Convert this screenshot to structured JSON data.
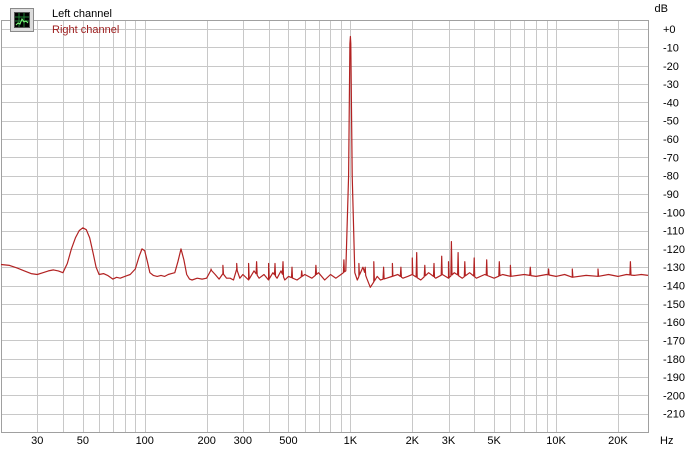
{
  "chart_data": {
    "type": "line",
    "title": "",
    "xscale": "log",
    "xlim": [
      20,
      28000
    ],
    "ylim": [
      -220,
      5
    ],
    "x_unit": "Hz",
    "y_unit": "dB",
    "x_ticks": [
      {
        "v": 30,
        "label": "30"
      },
      {
        "v": 50,
        "label": "50"
      },
      {
        "v": 100,
        "label": "100"
      },
      {
        "v": 200,
        "label": "200"
      },
      {
        "v": 300,
        "label": "300"
      },
      {
        "v": 500,
        "label": "500"
      },
      {
        "v": 1000,
        "label": "1K"
      },
      {
        "v": 2000,
        "label": "2K"
      },
      {
        "v": 3000,
        "label": "3K"
      },
      {
        "v": 5000,
        "label": "5K"
      },
      {
        "v": 10000,
        "label": "10K"
      },
      {
        "v": 20000,
        "label": "20K"
      }
    ],
    "y_ticks": [
      {
        "v": 0,
        "label": "+0"
      },
      {
        "v": -10,
        "label": "-10"
      },
      {
        "v": -20,
        "label": "-20"
      },
      {
        "v": -30,
        "label": "-30"
      },
      {
        "v": -40,
        "label": "-40"
      },
      {
        "v": -50,
        "label": "-50"
      },
      {
        "v": -60,
        "label": "-60"
      },
      {
        "v": -70,
        "label": "-70"
      },
      {
        "v": -80,
        "label": "-80"
      },
      {
        "v": -90,
        "label": "-90"
      },
      {
        "v": -100,
        "label": "-100"
      },
      {
        "v": -110,
        "label": "-110"
      },
      {
        "v": -120,
        "label": "-120"
      },
      {
        "v": -130,
        "label": "-130"
      },
      {
        "v": -140,
        "label": "-140"
      },
      {
        "v": -150,
        "label": "-150"
      },
      {
        "v": -160,
        "label": "-160"
      },
      {
        "v": -170,
        "label": "-170"
      },
      {
        "v": -180,
        "label": "-180"
      },
      {
        "v": -190,
        "label": "-190"
      },
      {
        "v": -200,
        "label": "-200"
      },
      {
        "v": -210,
        "label": "-210"
      }
    ],
    "grid": true,
    "legend_position": "top-left",
    "series": [
      {
        "name": "Left channel",
        "color": "#000000",
        "points": []
      },
      {
        "name": "Right channel",
        "color": "#b22222",
        "points": [
          [
            20,
            -128.5
          ],
          [
            22,
            -129
          ],
          [
            24,
            -130.5
          ],
          [
            26,
            -132
          ],
          [
            28,
            -133.5
          ],
          [
            30,
            -134
          ],
          [
            32,
            -133
          ],
          [
            34,
            -132
          ],
          [
            36,
            -131.5
          ],
          [
            38,
            -132
          ],
          [
            40,
            -133
          ],
          [
            42,
            -128
          ],
          [
            44,
            -120
          ],
          [
            46,
            -114
          ],
          [
            48,
            -110
          ],
          [
            50,
            -108.5
          ],
          [
            52,
            -109.5
          ],
          [
            54,
            -114
          ],
          [
            56,
            -122
          ],
          [
            58,
            -130
          ],
          [
            60,
            -134
          ],
          [
            63,
            -133.5
          ],
          [
            66,
            -134.5
          ],
          [
            70,
            -136.5
          ],
          [
            73,
            -135.5
          ],
          [
            76,
            -136
          ],
          [
            80,
            -135
          ],
          [
            85,
            -134
          ],
          [
            90,
            -131
          ],
          [
            94,
            -124
          ],
          [
            97,
            -120
          ],
          [
            100,
            -121
          ],
          [
            103,
            -127
          ],
          [
            106,
            -133
          ],
          [
            110,
            -134.5
          ],
          [
            115,
            -135
          ],
          [
            120,
            -134.5
          ],
          [
            125,
            -135
          ],
          [
            130,
            -134
          ],
          [
            135,
            -133.5
          ],
          [
            140,
            -133
          ],
          [
            145,
            -127
          ],
          [
            150,
            -120
          ],
          [
            155,
            -126
          ],
          [
            160,
            -134
          ],
          [
            165,
            -136.5
          ],
          [
            170,
            -137
          ],
          [
            180,
            -136
          ],
          [
            190,
            -136.5
          ],
          [
            200,
            -136
          ],
          [
            210,
            -131.5
          ],
          [
            220,
            -134
          ],
          [
            230,
            -136.5
          ],
          [
            240,
            -133.5
          ],
          [
            250,
            -136
          ],
          [
            260,
            -136
          ],
          [
            270,
            -137
          ],
          [
            280,
            -131
          ],
          [
            290,
            -136
          ],
          [
            300,
            -134
          ],
          [
            320,
            -137
          ],
          [
            340,
            -132
          ],
          [
            360,
            -136
          ],
          [
            380,
            -134
          ],
          [
            400,
            -137
          ],
          [
            420,
            -133
          ],
          [
            440,
            -136
          ],
          [
            460,
            -132
          ],
          [
            480,
            -137
          ],
          [
            500,
            -135
          ],
          [
            550,
            -137
          ],
          [
            600,
            -134
          ],
          [
            650,
            -136
          ],
          [
            700,
            -133
          ],
          [
            750,
            -137
          ],
          [
            800,
            -134
          ],
          [
            850,
            -136
          ],
          [
            900,
            -134
          ],
          [
            950,
            -132
          ],
          [
            980,
            -80
          ],
          [
            995,
            -8
          ],
          [
            1000,
            -4
          ],
          [
            1005,
            -8
          ],
          [
            1020,
            -80
          ],
          [
            1050,
            -133
          ],
          [
            1080,
            -137
          ],
          [
            1100,
            -135
          ],
          [
            1150,
            -130
          ],
          [
            1200,
            -136
          ],
          [
            1250,
            -141
          ],
          [
            1300,
            -138
          ],
          [
            1350,
            -135
          ],
          [
            1400,
            -137
          ],
          [
            1500,
            -136
          ],
          [
            1600,
            -135
          ],
          [
            1700,
            -134
          ],
          [
            1800,
            -136
          ],
          [
            1900,
            -135
          ],
          [
            2000,
            -134
          ],
          [
            2200,
            -137
          ],
          [
            2400,
            -133
          ],
          [
            2600,
            -136
          ],
          [
            2800,
            -134
          ],
          [
            3000,
            -136
          ],
          [
            3200,
            -133
          ],
          [
            3500,
            -136
          ],
          [
            3800,
            -133
          ],
          [
            4100,
            -136
          ],
          [
            4500,
            -134
          ],
          [
            5000,
            -136
          ],
          [
            5500,
            -134
          ],
          [
            6000,
            -135
          ],
          [
            7000,
            -134
          ],
          [
            8000,
            -135
          ],
          [
            9000,
            -134
          ],
          [
            10000,
            -135
          ],
          [
            11000,
            -134
          ],
          [
            12000,
            -135.5
          ],
          [
            14000,
            -134.5
          ],
          [
            16000,
            -135
          ],
          [
            18000,
            -134
          ],
          [
            20000,
            -135
          ],
          [
            22000,
            -134
          ],
          [
            24000,
            -134.5
          ],
          [
            26000,
            -134
          ],
          [
            28000,
            -134.5
          ]
        ],
        "spikes": [
          [
            210,
            -131
          ],
          [
            240,
            -129
          ],
          [
            280,
            -128
          ],
          [
            320,
            -128
          ],
          [
            350,
            -127
          ],
          [
            400,
            -128
          ],
          [
            430,
            -128
          ],
          [
            470,
            -127
          ],
          [
            520,
            -130
          ],
          [
            580,
            -132
          ],
          [
            680,
            -129
          ],
          [
            930,
            -126
          ],
          [
            1100,
            -128
          ],
          [
            1180,
            -130
          ],
          [
            1300,
            -127
          ],
          [
            1450,
            -130
          ],
          [
            1600,
            -128
          ],
          [
            1760,
            -130
          ],
          [
            2000,
            -125
          ],
          [
            2100,
            -122
          ],
          [
            2300,
            -129
          ],
          [
            2550,
            -128
          ],
          [
            2780,
            -124
          ],
          [
            3000,
            -127
          ],
          [
            3100,
            -116
          ],
          [
            3340,
            -122
          ],
          [
            3600,
            -127
          ],
          [
            4000,
            -125
          ],
          [
            4600,
            -126
          ],
          [
            5300,
            -127
          ],
          [
            6000,
            -129
          ],
          [
            7500,
            -130
          ],
          [
            9200,
            -131
          ],
          [
            12000,
            -131
          ],
          [
            16000,
            -131
          ],
          [
            23000,
            -127
          ]
        ]
      }
    ]
  },
  "axis": {
    "y_unit": "dB",
    "x_unit": "Hz"
  },
  "legend": {
    "icon": "spectrum-analyzer-icon",
    "items": [
      {
        "label": "Left channel",
        "color": "#000000"
      },
      {
        "label": "Right channel",
        "color": "#9b1a1a"
      }
    ]
  },
  "colors": {
    "grid": "#c8c8c8",
    "plot_bg": "#ffffff",
    "frame": "#a0a0a0",
    "right_channel": "#b22222"
  }
}
